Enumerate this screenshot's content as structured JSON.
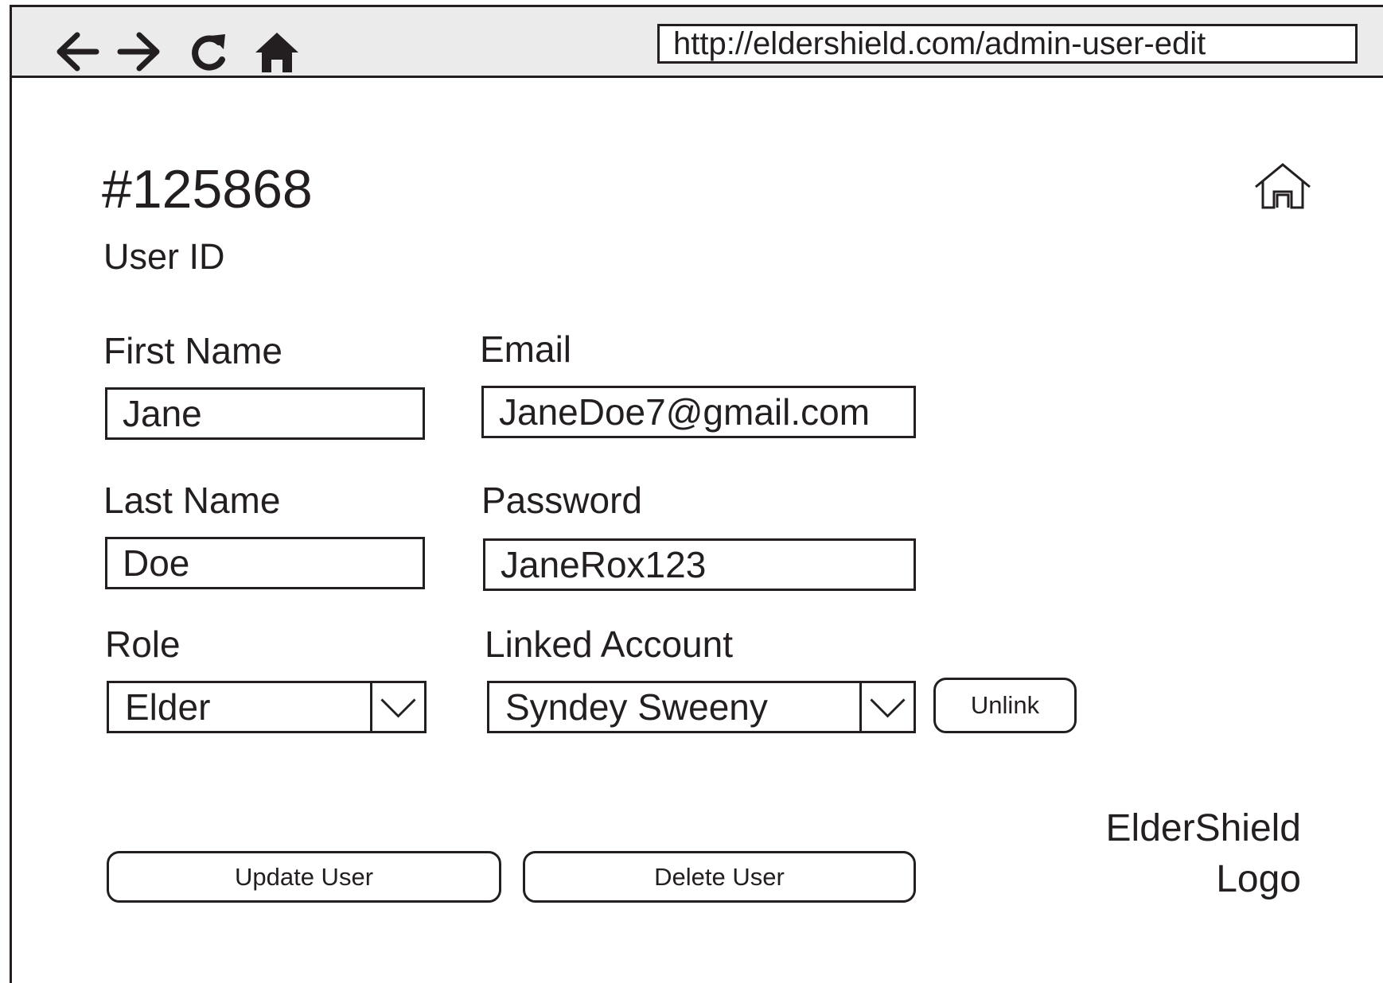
{
  "browser": {
    "url": "http://eldershield.com/admin-user-edit",
    "icons": [
      "back-arrow-icon",
      "forward-arrow-icon",
      "refresh-icon",
      "home-icon"
    ]
  },
  "header": {
    "user_id": "#125868",
    "user_id_label": "User ID",
    "home_icon": "home-outline-icon"
  },
  "form": {
    "first_name": {
      "label": "First Name",
      "value": "Jane"
    },
    "last_name": {
      "label": "Last Name",
      "value": "Doe"
    },
    "email": {
      "label": "Email",
      "value": "JaneDoe7@gmail.com"
    },
    "password": {
      "label": "Password",
      "value": "JaneRox123"
    },
    "role": {
      "label": "Role",
      "selected": "Elder"
    },
    "linked_account": {
      "label": "Linked Account",
      "selected": "Syndey Sweeny",
      "unlink_label": "Unlink"
    }
  },
  "actions": {
    "update_label": "Update User",
    "delete_label": "Delete User"
  },
  "logo": {
    "line1": "ElderShield",
    "line2": "Logo"
  }
}
